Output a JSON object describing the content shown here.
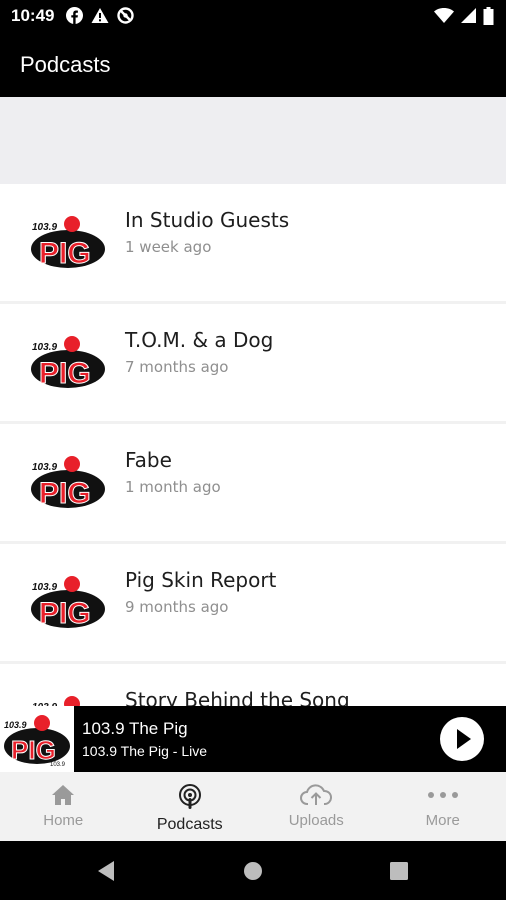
{
  "status": {
    "time": "10:49",
    "icons": [
      "facebook-icon",
      "warning-icon",
      "no-entry-icon",
      "wifi-icon",
      "signal-icon",
      "battery-icon"
    ]
  },
  "appbar": {
    "title": "Podcasts"
  },
  "podcasts": [
    {
      "name": "In Studio Guests",
      "updated": "1 week ago"
    },
    {
      "name": "T.O.M. & a Dog",
      "updated": "7 months ago"
    },
    {
      "name": "Fabe",
      "updated": "1 month ago"
    },
    {
      "name": "Pig Skin Report",
      "updated": "9 months ago"
    },
    {
      "name": "Story Behind the Song",
      "updated": ""
    }
  ],
  "logo": {
    "top": "103.9",
    "word": "PIG",
    "bottom": "103.9"
  },
  "player": {
    "title": "103.9 The Pig",
    "subtitle": "103.9 The Pig - Live"
  },
  "nav": [
    {
      "label": "Home",
      "icon": "home-icon"
    },
    {
      "label": "Podcasts",
      "icon": "podcast-icon"
    },
    {
      "label": "Uploads",
      "icon": "upload-cloud-icon"
    },
    {
      "label": "More",
      "icon": "more-icon"
    }
  ],
  "colors": {
    "brand_red": "#e8202a",
    "bar_black": "#000000",
    "inactive_tab": "#9a9a9a"
  }
}
